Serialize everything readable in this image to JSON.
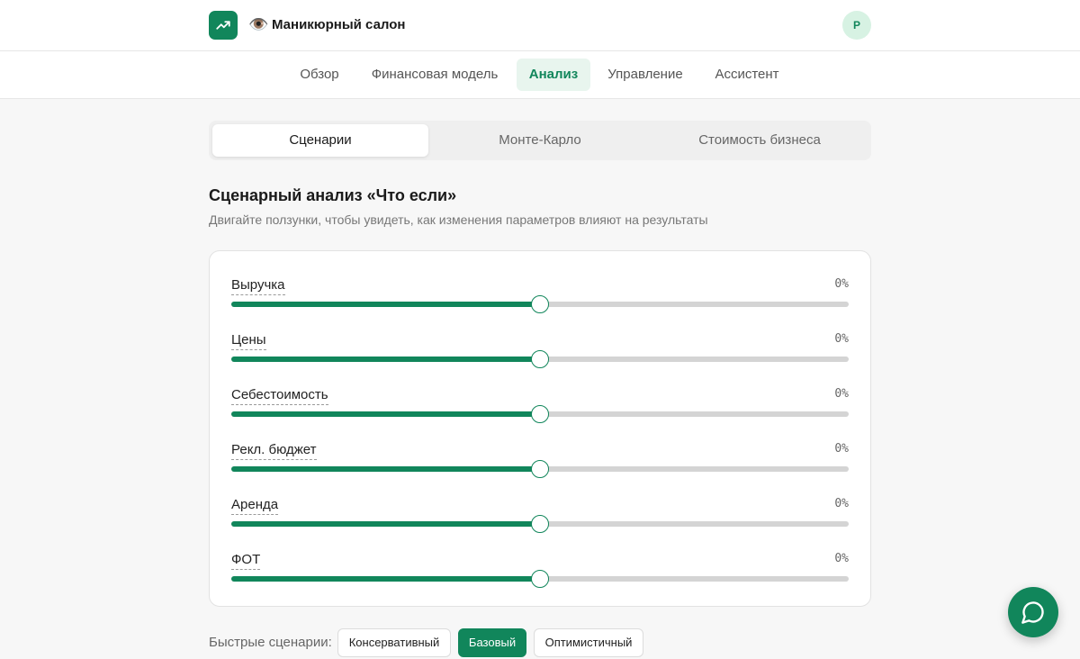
{
  "header": {
    "app_emoji": "👁️",
    "app_title": "Маникюрный салон",
    "avatar_initial": "Р"
  },
  "nav": {
    "items": [
      {
        "label": "Обзор",
        "active": false
      },
      {
        "label": "Финансовая модель",
        "active": false
      },
      {
        "label": "Анализ",
        "active": true
      },
      {
        "label": "Управление",
        "active": false
      },
      {
        "label": "Ассистент",
        "active": false
      }
    ]
  },
  "subtabs": {
    "items": [
      {
        "label": "Сценарии",
        "active": true
      },
      {
        "label": "Монте-Карло",
        "active": false
      },
      {
        "label": "Стоимость бизнеса",
        "active": false
      }
    ]
  },
  "scenario": {
    "title": "Сценарный анализ «Что если»",
    "subtitle": "Двигайте ползунки, чтобы увидеть, как изменения параметров влияют на результаты",
    "sliders": [
      {
        "label": "Выручка",
        "value": "0%",
        "position": 0.5
      },
      {
        "label": "Цены",
        "value": "0%",
        "position": 0.5
      },
      {
        "label": "Себестоимость",
        "value": "0%",
        "position": 0.5
      },
      {
        "label": "Рекл. бюджет",
        "value": "0%",
        "position": 0.5
      },
      {
        "label": "Аренда",
        "value": "0%",
        "position": 0.5
      },
      {
        "label": "ФОТ",
        "value": "0%",
        "position": 0.5
      }
    ]
  },
  "quick": {
    "label": "Быстрые сценарии:",
    "buttons": [
      {
        "label": "Консервативный",
        "active": false
      },
      {
        "label": "Базовый",
        "active": true
      },
      {
        "label": "Оптимистичный",
        "active": false
      }
    ]
  },
  "colors": {
    "accent": "#11865b",
    "accent_light": "#e8f5ee",
    "track": "#d4d4d4"
  },
  "icons": {
    "logo": "trending-up-icon",
    "chat": "chat-bubble-icon"
  }
}
